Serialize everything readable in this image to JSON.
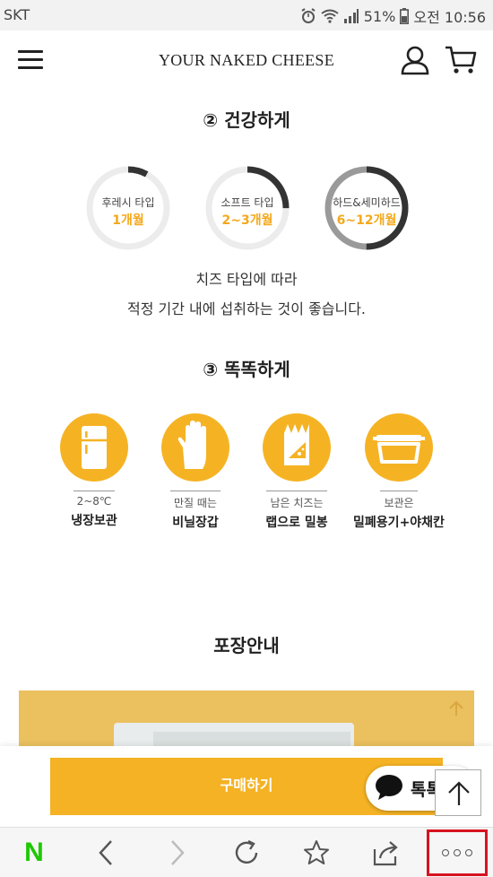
{
  "statusbar": {
    "carrier": "SKT",
    "battery": "51%",
    "time": "오전 10:56"
  },
  "header": {
    "brand": "YOUR NAKED CHEESE"
  },
  "healthy": {
    "title": "② 건강하게",
    "rings": [
      {
        "label": "후레시 타입",
        "value": "1개월",
        "progress": 0.08
      },
      {
        "label": "소프트 타입",
        "value": "2~3개월",
        "progress": 0.25
      },
      {
        "label": "하드&세미하드",
        "value": "6~12개월",
        "progress": 0.5
      }
    ],
    "desc_line1": "치즈 타입에 따라",
    "desc_line2": "적정 기간 내에 섭취하는 것이 좋습니다."
  },
  "smart": {
    "title": "③ 똑똑하게",
    "tips": [
      {
        "icon": "fridge-icon",
        "caption": "2~8℃",
        "main": "냉장보관"
      },
      {
        "icon": "glove-icon",
        "caption": "만질 때는",
        "main": "비닐장갑"
      },
      {
        "icon": "cheese-wrap-icon",
        "caption": "남은 치즈는",
        "main": "랩으로 밀봉"
      },
      {
        "icon": "container-icon",
        "caption": "보관은",
        "main": "밀폐용기+야채칸"
      }
    ]
  },
  "packaging": {
    "title": "포장안내"
  },
  "purchase": {
    "buy_label": "구매하기",
    "talk_label": "톡톡"
  },
  "colors": {
    "accent": "#f4b224",
    "dark": "#333333",
    "naver": "#1ec800",
    "highlight": "#d7131f"
  }
}
